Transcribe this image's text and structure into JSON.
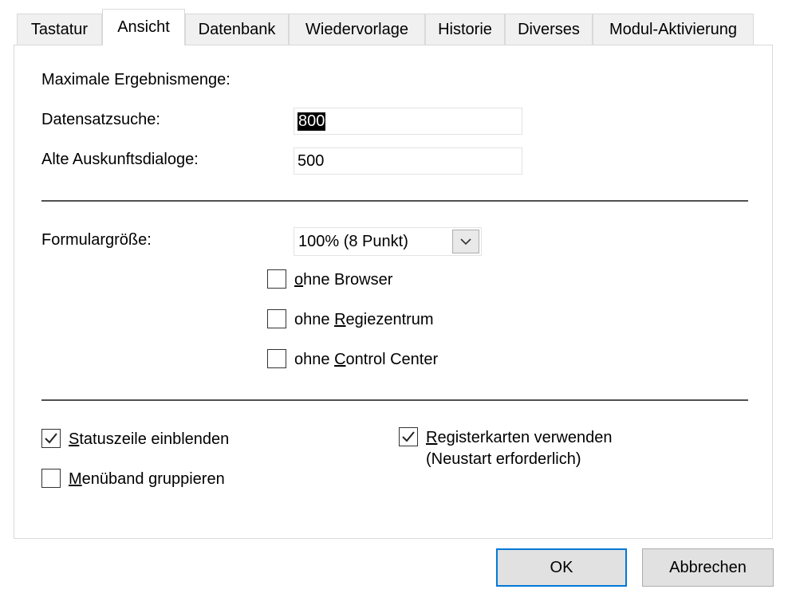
{
  "tabs": [
    {
      "label": "Tastatur"
    },
    {
      "label": "Ansicht"
    },
    {
      "label": "Datenbank"
    },
    {
      "label": "Wiedervorlage"
    },
    {
      "label": "Historie"
    },
    {
      "label": "Diverses"
    },
    {
      "label": "Modul-Aktivierung"
    }
  ],
  "active_tab": "Ansicht",
  "results": {
    "heading": "Maximale Ergebnismenge:",
    "record_search_label": "Datensatzsuche:",
    "record_search_value": "800",
    "old_dialogs_label": "Alte Auskunftsdialoge:",
    "old_dialogs_value": "500"
  },
  "form": {
    "size_label": "Formulargröße:",
    "size_value": "100% (8 Punkt)",
    "opt_browser_prefix": "",
    "opt_browser_mnemonic": "o",
    "opt_browser_rest": "hne Browser",
    "opt_browser_checked": false,
    "opt_regie_prefix": "ohne ",
    "opt_regie_mnemonic": "R",
    "opt_regie_rest": "egiezentrum",
    "opt_regie_checked": false,
    "opt_control_prefix": "ohne ",
    "opt_control_mnemonic": "C",
    "opt_control_rest": "ontrol Center",
    "opt_control_checked": false
  },
  "bottom": {
    "status_mnemonic": "S",
    "status_rest": "tatuszeile einblenden",
    "status_checked": true,
    "ribbon_mnemonic": "M",
    "ribbon_rest": "enüband gruppieren",
    "ribbon_checked": false,
    "tabs_mnemonic": "R",
    "tabs_rest": "egisterkarten verwenden",
    "tabs_note": "(Neustart erforderlich)",
    "tabs_checked": true
  },
  "buttons": {
    "ok": "OK",
    "cancel": "Abbrechen"
  },
  "colors": {
    "default_button_border": "#0078d7",
    "tab_inactive_bg": "#f0f0f0"
  },
  "icons": {
    "combo_arrow": "chevron-down-icon",
    "check": "checkmark-icon"
  }
}
